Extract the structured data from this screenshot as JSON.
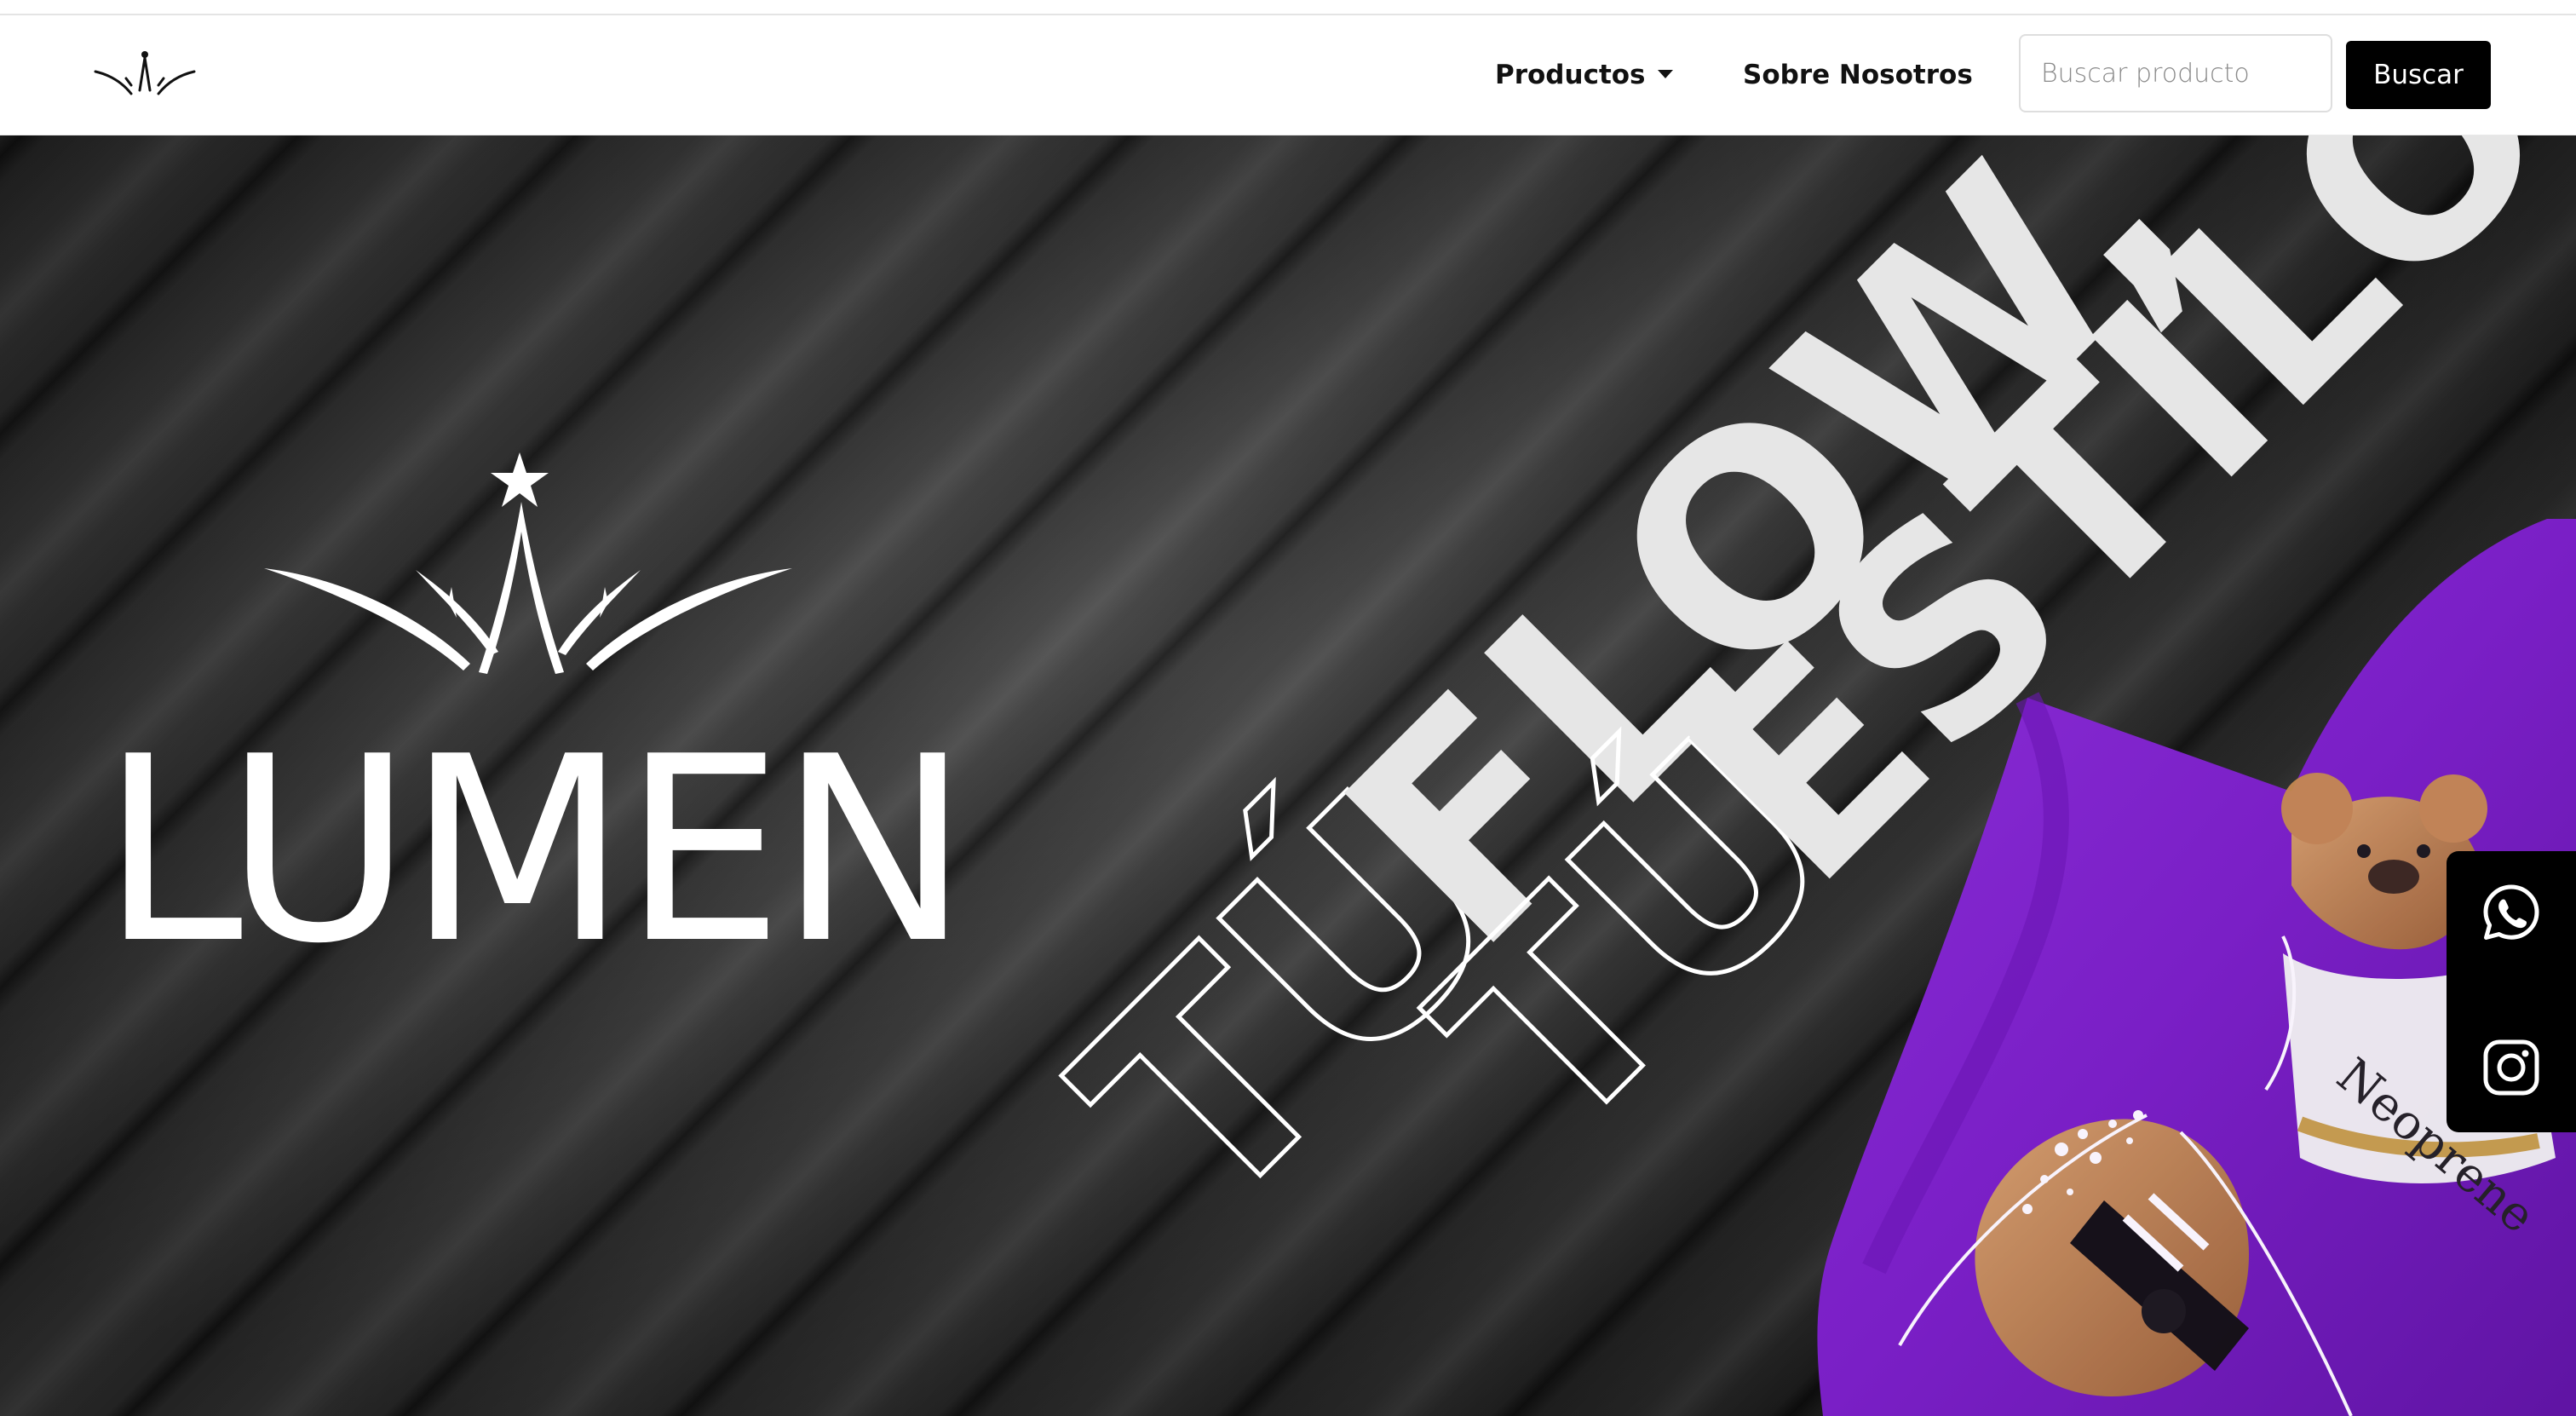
{
  "nav": {
    "products_label": "Productos",
    "about_label": "Sobre Nosotros",
    "search_placeholder": "Buscar producto",
    "search_button": "Buscar"
  },
  "hero": {
    "brand": "LUMEN",
    "slogan_line1_outline": "TÚ",
    "slogan_line1_solid": "FLOW,",
    "slogan_line2_outline": "TÚ",
    "slogan_line2_solid": "ESTILO!",
    "product_print_text": "Neoprene"
  },
  "social": {
    "whatsapp_icon": "whatsapp-icon",
    "instagram_icon": "instagram-icon"
  },
  "colors": {
    "accent": "#000000",
    "product_purple": "#7b22c8",
    "hero_dark": "#2a2a2a"
  }
}
